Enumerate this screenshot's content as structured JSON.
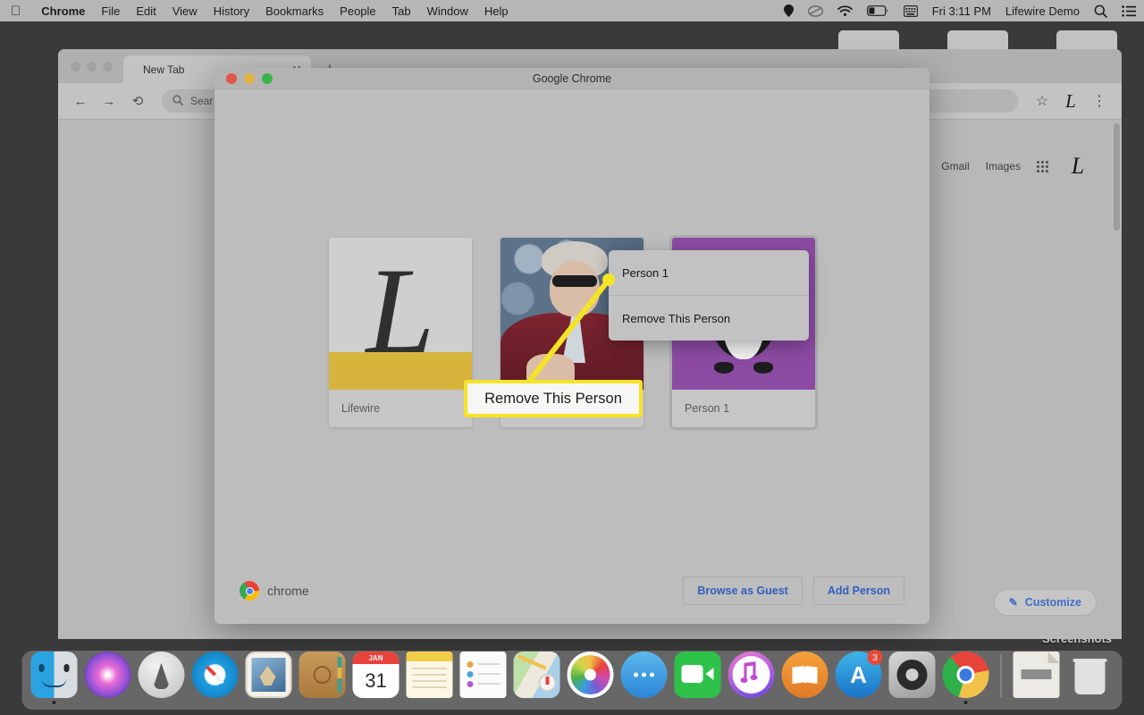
{
  "menubar": {
    "apple_icon": "apple-icon",
    "items": [
      {
        "label": "Chrome",
        "bold": true
      },
      {
        "label": "File",
        "bold": false
      },
      {
        "label": "Edit",
        "bold": false
      },
      {
        "label": "View",
        "bold": false
      },
      {
        "label": "History",
        "bold": false
      },
      {
        "label": "Bookmarks",
        "bold": false
      },
      {
        "label": "People",
        "bold": false
      },
      {
        "label": "Tab",
        "bold": false
      },
      {
        "label": "Window",
        "bold": false
      },
      {
        "label": "Help",
        "bold": false
      }
    ],
    "status": {
      "clock": "Fri 3:11 PM",
      "user": "Lifewire Demo",
      "icons": [
        "location-icon",
        "creative-cloud-icon",
        "wifi-icon",
        "battery-icon",
        "input-menu-icon"
      ],
      "search_icon": "search-icon",
      "control-center_icon": "control-center-icon"
    }
  },
  "desktop": {
    "folder_label": "Screenshots"
  },
  "chrome_window": {
    "tab": {
      "title": "New Tab",
      "close_icon": "close-icon"
    },
    "new_tab_button": "+",
    "toolbar": {
      "back_icon": "back-arrow-icon",
      "forward_icon": "forward-arrow-icon",
      "reload_icon": "reload-icon",
      "omnibox_placeholder": "Search Google or type a URL",
      "omnibox_value": "Sear",
      "search_icon": "search-icon",
      "bookmark_icon": "star-icon",
      "profile_avatar": "L",
      "menu_icon": "three-dot-menu-icon"
    },
    "new_tab_page": {
      "gmail_link": "Gmail",
      "images_link": "Images",
      "apps_icon": "apps-grid-icon",
      "avatar_letter": "L",
      "customize_label": "Customize",
      "customize_icon": "pencil-icon"
    }
  },
  "profile_modal": {
    "title": "Google Chrome",
    "window_controls": {
      "close": "close-button",
      "minimize": "minimize-button",
      "zoom": "zoom-button"
    },
    "profiles": [
      {
        "name": "Lifewire",
        "avatar": "lifewire-logo",
        "selected": false
      },
      {
        "name": "",
        "avatar": "photo-portrait",
        "selected": false
      },
      {
        "name": "Person 1",
        "avatar": "penguin-purple",
        "selected": true
      }
    ],
    "context_menu": {
      "header": "Person 1",
      "items": [
        "Remove This Person"
      ]
    },
    "footer": {
      "brand": "chrome",
      "brand_icon": "chrome-logo-icon",
      "browse_guest_label": "Browse as Guest",
      "add_person_label": "Add Person"
    }
  },
  "annotation": {
    "callout_text": "Remove This Person",
    "border_color": "#f5e327",
    "fill_color": "#f7f7f5"
  },
  "dock": {
    "items": [
      {
        "name": "finder",
        "running": true
      },
      {
        "name": "siri",
        "running": false
      },
      {
        "name": "launchpad",
        "running": false
      },
      {
        "name": "safari",
        "running": false
      },
      {
        "name": "mail",
        "running": false
      },
      {
        "name": "contacts",
        "running": false
      },
      {
        "name": "calendar",
        "running": false,
        "month": "JAN",
        "day": "31"
      },
      {
        "name": "notes",
        "running": false
      },
      {
        "name": "reminders",
        "running": false
      },
      {
        "name": "maps",
        "running": false
      },
      {
        "name": "photos",
        "running": false
      },
      {
        "name": "messages",
        "running": false
      },
      {
        "name": "facetime",
        "running": false
      },
      {
        "name": "itunes",
        "running": false
      },
      {
        "name": "books",
        "running": false
      },
      {
        "name": "app-store",
        "running": false,
        "badge": "3"
      },
      {
        "name": "system-preferences",
        "running": false
      },
      {
        "name": "chrome",
        "running": true
      },
      {
        "name": "document",
        "running": false
      },
      {
        "name": "trash",
        "running": false
      }
    ]
  }
}
